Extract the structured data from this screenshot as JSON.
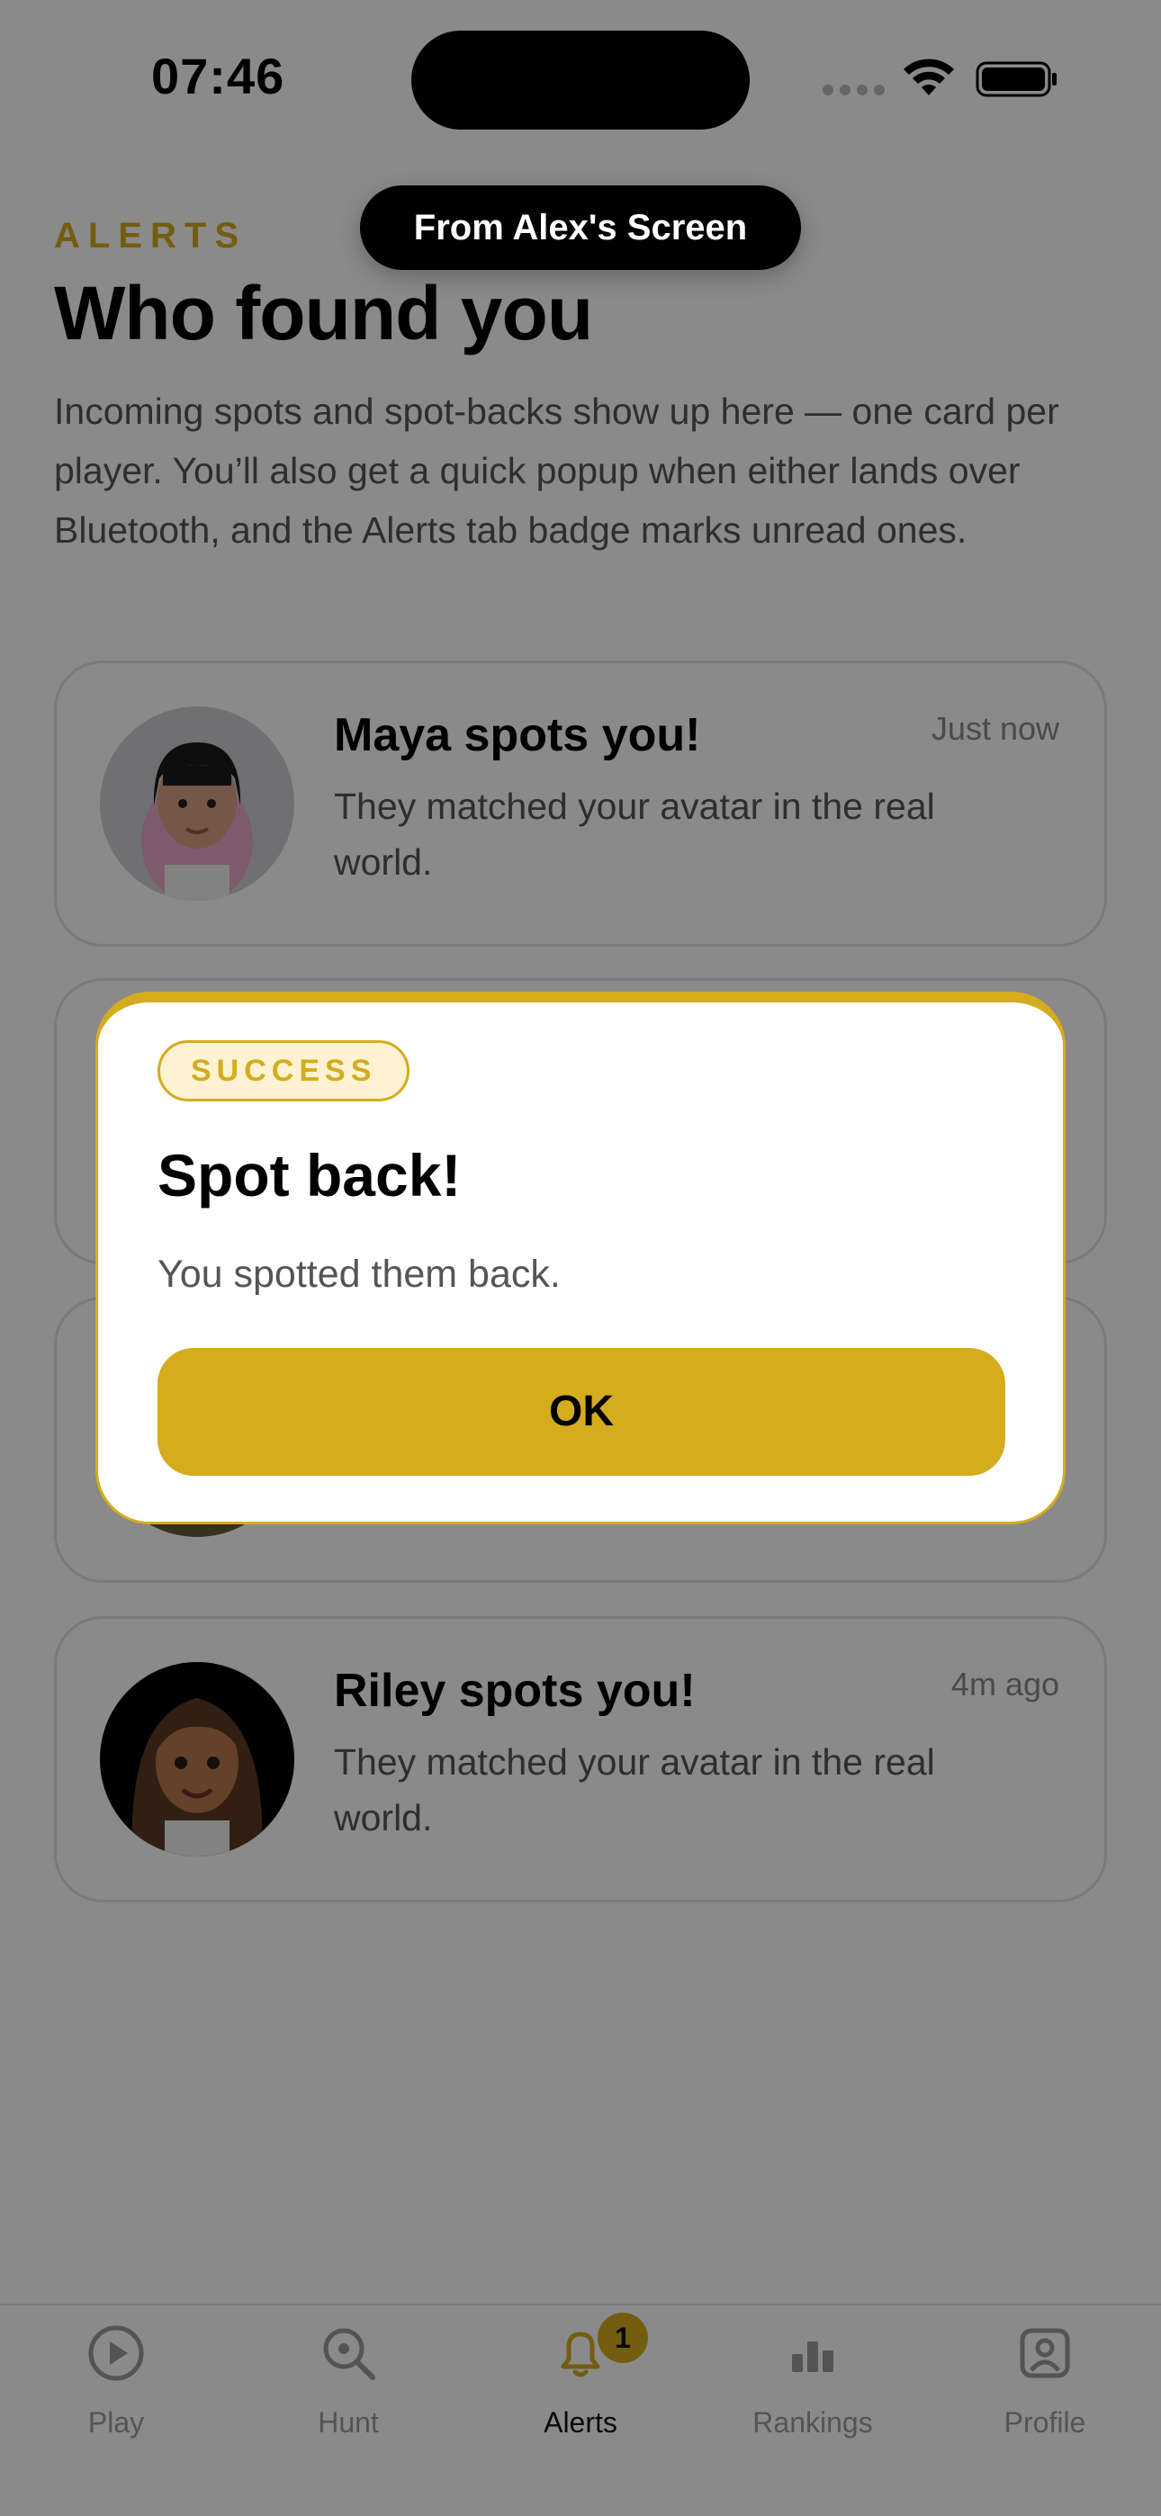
{
  "status_bar": {
    "time": "07:46"
  },
  "toast": {
    "text": "From Alex's Screen"
  },
  "header": {
    "eyebrow": "ALERTS",
    "title": "Who found you",
    "description": "Incoming spots and spot-backs show up here — one card per player. You’ll also get a quick popup when either lands over Bluetooth, and the Alerts tab badge marks unread ones."
  },
  "cards": [
    {
      "title": "Maya spots you!",
      "time": "Just now",
      "body": "They matched your avatar in the real world.",
      "avatar": "avatar-maya"
    },
    {
      "title": "",
      "time": "",
      "body": "",
      "avatar": "avatar-hidden-1"
    },
    {
      "title": "",
      "time": "",
      "body": "",
      "avatar": "avatar-hidden-2"
    },
    {
      "title": "Riley spots you!",
      "time": "4m ago",
      "body": "They matched your avatar in the real world.",
      "avatar": "avatar-riley"
    }
  ],
  "modal": {
    "tag": "SUCCESS",
    "title": "Spot back!",
    "body": "You spotted them back.",
    "ok_label": "OK"
  },
  "tab_bar": {
    "tabs": [
      {
        "label": "Play",
        "icon": "play-icon"
      },
      {
        "label": "Hunt",
        "icon": "search-icon"
      },
      {
        "label": "Alerts",
        "icon": "bell-icon",
        "badge": "1"
      },
      {
        "label": "Rankings",
        "icon": "bar-chart-icon"
      },
      {
        "label": "Profile",
        "icon": "profile-icon"
      }
    ],
    "active_index": 2
  },
  "colors": {
    "accent": "#d4ac1e",
    "text": "#000000",
    "muted": "#555555"
  }
}
